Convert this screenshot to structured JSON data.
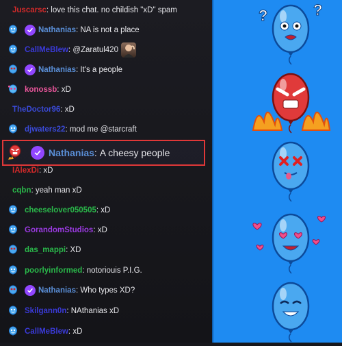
{
  "colors": {
    "panel_bg": "#1e8bf2",
    "highlight_border": "#e03838",
    "verified_badge": "#9146ff"
  },
  "chat": {
    "messages": [
      {
        "badge": "none",
        "verified": false,
        "name": "Juscarsc",
        "name_color": "#d42a2a",
        "separator": ":",
        "text": "love this chat. no childish \"xD\" spam"
      },
      {
        "badge": "balloon-blue-icon",
        "verified": true,
        "name": "Nathanias",
        "name_color": "#5a8fd8",
        "separator": ":",
        "text": "NA is not a place"
      },
      {
        "badge": "balloon-blue-icon",
        "verified": false,
        "name": "CallMeBlew",
        "name_color": "#3a3ad8",
        "separator": ":",
        "text": "@Zaratul420",
        "emote": "streamer-emote-icon"
      },
      {
        "badge": "balloon-dizzy-icon",
        "verified": true,
        "name": "Nathanias",
        "name_color": "#5a8fd8",
        "separator": ":",
        "text": "It's a people"
      },
      {
        "badge": "balloon-love-icon",
        "verified": false,
        "name": "konossb",
        "name_color": "#e8559a",
        "separator": ":",
        "text": "xD"
      },
      {
        "badge": "none",
        "verified": false,
        "name": "TheDoctor96",
        "name_color": "#3a4ad8",
        "separator": ":",
        "text": "xD"
      },
      {
        "badge": "balloon-blue-icon",
        "verified": false,
        "name": "djwaters22",
        "name_color": "#3a4ad8",
        "separator": ":",
        "text": "mod me @starcraft"
      },
      {
        "badge": "none",
        "verified": false,
        "name": "IAlexDi",
        "name_color": "#d42a2a",
        "separator": ":",
        "text": "xD"
      },
      {
        "badge": "none",
        "verified": false,
        "name": "cqbn",
        "name_color": "#2ab84a",
        "separator": ":",
        "text": "yeah man xD"
      },
      {
        "badge": "balloon-blue-icon",
        "verified": false,
        "name": "cheeselover050505",
        "name_color": "#2ab84a",
        "separator": ":",
        "text": "xD"
      },
      {
        "badge": "balloon-blue-icon",
        "verified": false,
        "name": "GorandomStudios",
        "name_color": "#9a3ae0",
        "separator": ":",
        "text": "xD"
      },
      {
        "badge": "balloon-dizzy-icon",
        "verified": false,
        "name": "das_mappi",
        "name_color": "#2ab84a",
        "separator": ":",
        "text": "XD"
      },
      {
        "badge": "balloon-blue-icon",
        "verified": false,
        "name": "poorlyinformed",
        "name_color": "#2ab84a",
        "separator": ":",
        "text": "notoriouis P.I.G."
      },
      {
        "badge": "balloon-dizzy-icon",
        "verified": true,
        "name": "Nathanias",
        "name_color": "#5a8fd8",
        "separator": ":",
        "text": "Who types XD?"
      },
      {
        "badge": "balloon-blue-icon",
        "verified": false,
        "name": "Skilgann0n",
        "name_color": "#3a3ad8",
        "separator": ":",
        "text": "NAthanias xD"
      },
      {
        "badge": "balloon-blue-icon",
        "verified": false,
        "name": "CallMeBlew",
        "name_color": "#3a3ad8",
        "separator": ":",
        "text": "xD"
      }
    ],
    "highlighted": {
      "badge": "balloon-angry-icon",
      "verified": true,
      "name": "Nathanias",
      "name_color": "#5a8fd8",
      "separator": ":",
      "text": "A cheesy people"
    }
  },
  "emote_panel": {
    "emotes": [
      {
        "icon": "balloon-confused-icon"
      },
      {
        "icon": "balloon-angry-fire-icon"
      },
      {
        "icon": "balloon-dizzy-icon"
      },
      {
        "icon": "balloon-love-icon"
      },
      {
        "icon": "balloon-happy-icon"
      }
    ]
  }
}
